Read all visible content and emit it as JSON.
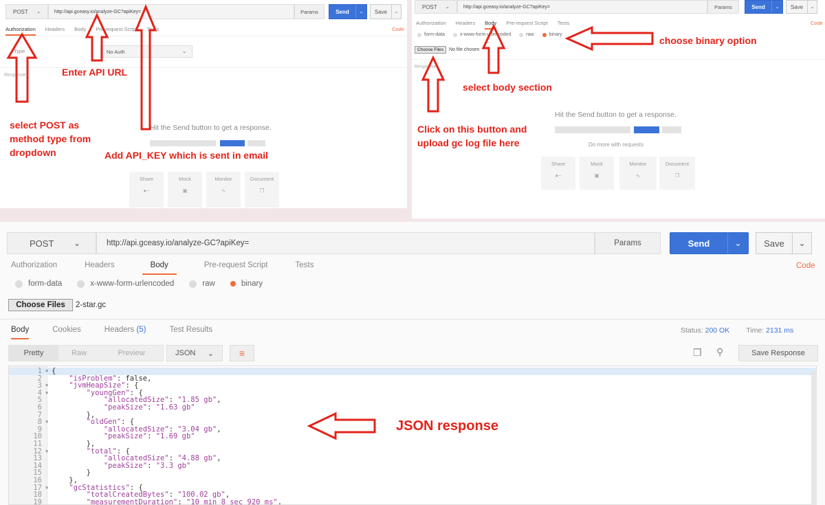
{
  "panel_top_left": {
    "method": "POST",
    "url": "http://api.gceasy.io/analyze-GC?apiKey=",
    "params": "Params",
    "send": "Send",
    "save": "Save",
    "tabs": [
      "Authorization",
      "Headers",
      "Body",
      "Pre-request Script",
      "Tests"
    ],
    "code": "Code",
    "type_label": "Type",
    "auth_value": "No Auth",
    "response_label": "Response",
    "hint": "Hit the Send button to get a response.",
    "tiles": [
      "Share",
      "Mock",
      "Monitor",
      "Document"
    ],
    "annotations": {
      "api_url": "Enter API URL",
      "post": "select POST as method type from dropdown",
      "api_key": "Add API_KEY which is sent in email"
    }
  },
  "panel_top_right": {
    "method": "POST",
    "url": "http://api.gceasy.io/analyze-GC?apiKey=",
    "params": "Params",
    "send": "Send",
    "save": "Save",
    "tabs": [
      "Authorization",
      "Headers",
      "Body",
      "Pre-request Script",
      "Tests"
    ],
    "code": "Code",
    "radios": [
      "form-data",
      "x-www-form-urlencoded",
      "raw",
      "binary"
    ],
    "choose_files": "Choose Files",
    "no_file": "No file chosen",
    "response_label": "Response",
    "hint": "Hit the Send button to get a response.",
    "more": "Do more with requests",
    "tiles": [
      "Share",
      "Mock",
      "Monitor",
      "Document"
    ],
    "annotations": {
      "binary": "choose binary option",
      "body": "select body section",
      "upload": "Click on this button and upload gc log file here"
    }
  },
  "panel_bottom": {
    "method": "POST",
    "url": "http://api.gceasy.io/analyze-GC?apiKey=",
    "params": "Params",
    "send": "Send",
    "save": "Save",
    "tabs": [
      "Authorization",
      "Headers",
      "Body",
      "Pre-request Script",
      "Tests"
    ],
    "code": "Code",
    "radios": [
      "form-data",
      "x-www-form-urlencoded",
      "raw",
      "binary"
    ],
    "choose_files": "Choose Files",
    "file_name": "2-star.gc",
    "resp_tabs": [
      "Body",
      "Cookies",
      "Headers",
      "Test Results"
    ],
    "headers_count": "(5)",
    "status_label": "Status:",
    "status_value": "200 OK",
    "time_label": "Time:",
    "time_value": "2131 ms",
    "view_tabs": [
      "Pretty",
      "Raw",
      "Preview"
    ],
    "format": "JSON",
    "save_response": "Save Response",
    "annotation": "JSON response",
    "code_lines": [
      {
        "n": "1",
        "t": "{"
      },
      {
        "n": "2",
        "t": "    \"isProblem\": false,"
      },
      {
        "n": "3",
        "t": "    \"jvmHeapSize\": {"
      },
      {
        "n": "4",
        "t": "        \"youngGen\": {"
      },
      {
        "n": "5",
        "t": "            \"allocatedSize\": \"1.85 gb\","
      },
      {
        "n": "6",
        "t": "            \"peakSize\": \"1.63 gb\""
      },
      {
        "n": "7",
        "t": "        },"
      },
      {
        "n": "8",
        "t": "        \"oldGen\": {"
      },
      {
        "n": "9",
        "t": "            \"allocatedSize\": \"3.04 gb\","
      },
      {
        "n": "10",
        "t": "            \"peakSize\": \"1.69 gb\""
      },
      {
        "n": "11",
        "t": "        },"
      },
      {
        "n": "12",
        "t": "        \"total\": {"
      },
      {
        "n": "13",
        "t": "            \"allocatedSize\": \"4.88 gb\","
      },
      {
        "n": "14",
        "t": "            \"peakSize\": \"3.3 gb\""
      },
      {
        "n": "15",
        "t": "        }"
      },
      {
        "n": "16",
        "t": "    },"
      },
      {
        "n": "17",
        "t": "    \"gcStatistics\": {"
      },
      {
        "n": "18",
        "t": "        \"totalCreatedBytes\": \"100.02 gb\","
      },
      {
        "n": "19",
        "t": "        \"measurementDuration\": \"10 min 8 sec 920 ms\","
      }
    ]
  },
  "colors": {
    "accent": "#f26b3a",
    "send": "#3b73d9",
    "annotation": "#e2231a"
  }
}
